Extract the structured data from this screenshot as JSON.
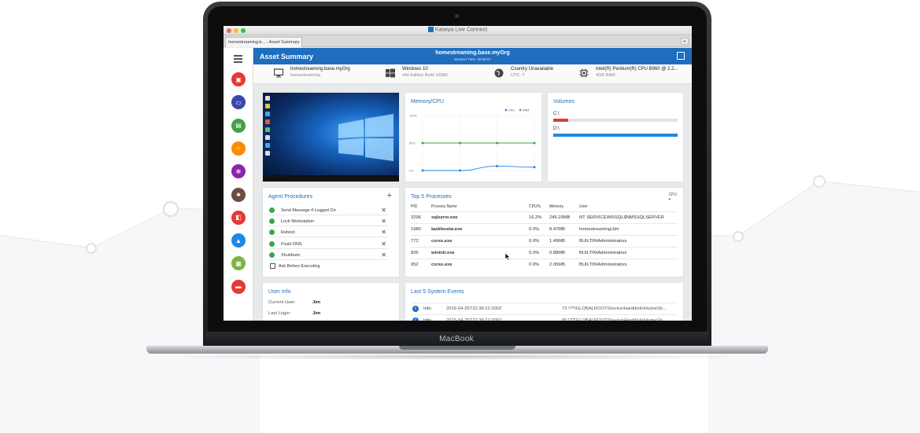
{
  "window": {
    "title": "Kaseya Live Connect"
  },
  "tab": {
    "label": "homestreaming.b... - Asset Summary",
    "new_tab": "+"
  },
  "header": {
    "title": "Asset Summary",
    "host": "homestreaming.base.myOrg",
    "session": "Session Time: 00:00:57"
  },
  "infobar": {
    "machine": {
      "name": "homestreaming.base.myOrg",
      "sub": "homestreaming",
      "icon": "monitor-icon"
    },
    "os": {
      "name": "Windows 10",
      "sub": "x64 Edition Build 10586",
      "icon": "windows-icon"
    },
    "location": {
      "name": "Country Unavailable",
      "sub": "UTC -7",
      "icon": "globe-icon"
    },
    "cpu": {
      "name": "Intel(R) Pentium(R) CPU B960 @ 2.2...",
      "sub": "4GB RAM",
      "icon": "cpu-chip-icon"
    }
  },
  "sidebar": {
    "items": [
      {
        "name": "asset-summary",
        "color": "#e53935",
        "icon": "dashboard-icon"
      },
      {
        "name": "remote-control",
        "color": "#3949ab",
        "icon": "monitor-icon"
      },
      {
        "name": "files",
        "color": "#43a047",
        "icon": "folder-icon"
      },
      {
        "name": "command-shell",
        "color": "#fb8c00",
        "icon": "code-icon"
      },
      {
        "name": "services",
        "color": "#8e24aa",
        "icon": "gear-icon"
      },
      {
        "name": "network",
        "color": "#6d4c41",
        "icon": "network-icon"
      },
      {
        "name": "events",
        "color": "#e53935",
        "icon": "book-icon"
      },
      {
        "name": "alerts",
        "color": "#1e88e5",
        "icon": "warning-icon"
      },
      {
        "name": "tickets",
        "color": "#7cb342",
        "icon": "clipboard-icon"
      },
      {
        "name": "chat",
        "color": "#e53935",
        "icon": "chat-icon"
      }
    ]
  },
  "memory_cpu": {
    "title": "Memory/CPU",
    "legend": [
      "CPU",
      "RAM"
    ],
    "colors": {
      "cpu": "#1e88e5",
      "ram": "#43a047"
    }
  },
  "chart_data": {
    "type": "line",
    "title": "Memory/CPU",
    "x": [
      0,
      1,
      2,
      3
    ],
    "ylim": [
      0,
      100
    ],
    "yticks": [
      "100%",
      "50%",
      "0%"
    ],
    "series": [
      {
        "name": "CPU",
        "values": [
          0,
          0,
          8,
          6
        ]
      },
      {
        "name": "RAM",
        "values": [
          50,
          50,
          50,
          50
        ]
      }
    ]
  },
  "volumes": {
    "title": "Volumes",
    "items": [
      {
        "label": "C:\\",
        "fill": 0.12,
        "color": "#e53935"
      },
      {
        "label": "D:\\",
        "fill": 1.0,
        "color": "#1e88e5"
      }
    ]
  },
  "agent_procedures": {
    "title": "Agent Procedures",
    "add": "+",
    "items": [
      "Send Message if Logged On",
      "Lock Workstation",
      "Reboot",
      "Flush DNS",
      "Shutdown"
    ],
    "ask_before": "Ask Before Executing"
  },
  "top5": {
    "title": "Top 5 Processes",
    "sort": "CPU",
    "columns": [
      "PID",
      "Process Name",
      "CPU%",
      "Memory",
      "User"
    ],
    "rows": [
      [
        "3296",
        "sqlservr.exe",
        "16.2%",
        "246.29MB",
        "NT SERVICE\\MSSQL$NMSSQLSERVER"
      ],
      [
        "1980",
        "taskhostw.exe",
        "0.0%",
        "8.47MB",
        "homestreaming\\Jim"
      ],
      [
        "772",
        "csrss.exe",
        "0.0%",
        "1.49MB",
        "BUILTIN\\Administrators"
      ],
      [
        "836",
        "wininit.exe",
        "0.0%",
        "0.88MB",
        "BUILTIN\\Administrators"
      ],
      [
        "952",
        "csrss.exe",
        "0.0%",
        "2.05MB",
        "BUILTIN\\Administrators"
      ]
    ]
  },
  "user_info": {
    "title": "User Info",
    "rows": [
      {
        "label": "Current User:",
        "value": "Jim"
      },
      {
        "label": "Last Login:",
        "value": "Jim"
      }
    ]
  },
  "events": {
    "title": "Last 5 System Events",
    "rows": [
      {
        "type": "Info",
        "time": "2016-04-25T22:38:22.000Z",
        "msg": "73 \\??\\GLOBALROOT\\Device\\HarddiskVolumeSh..."
      },
      {
        "type": "Info",
        "time": "2016-04-25T22:38:22.000Z",
        "msg": "80 \\??\\GLOBALROOT\\Device\\HarddiskVolumeSh..."
      }
    ]
  },
  "laptop": {
    "brand": "MacBook"
  }
}
